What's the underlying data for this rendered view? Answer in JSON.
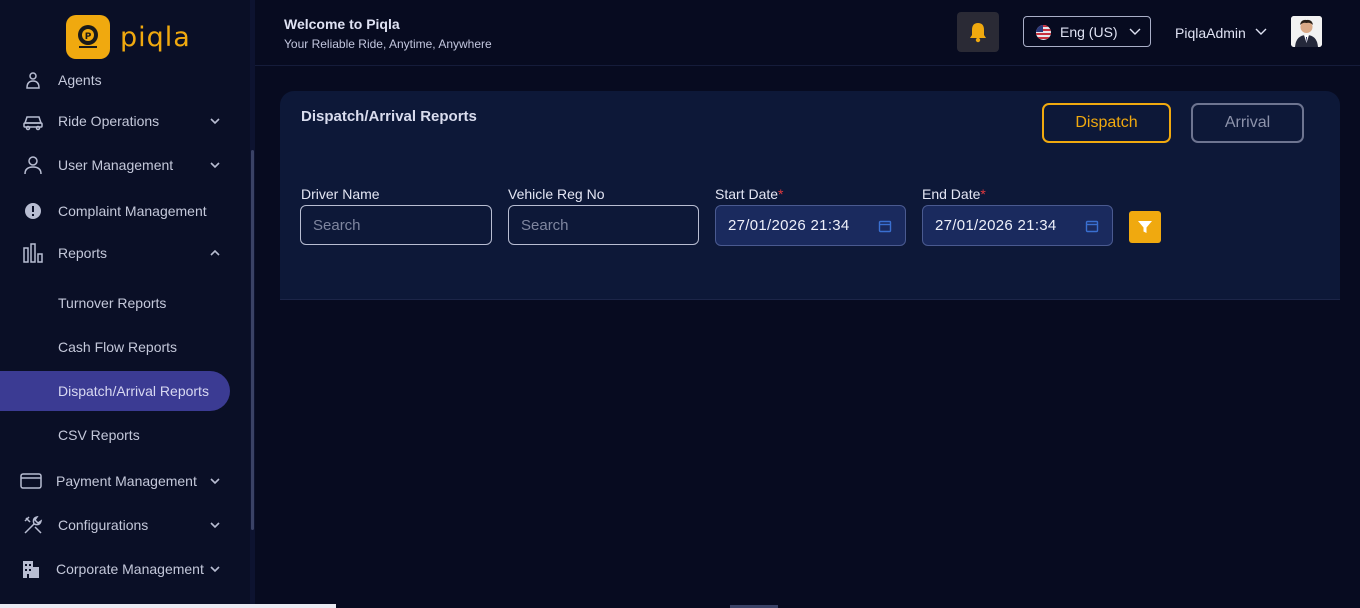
{
  "app": {
    "logo_text": "piqla"
  },
  "sidebar": {
    "items": [
      {
        "label": "Agents",
        "icon": "agents-icon"
      },
      {
        "label": "Ride Operations",
        "icon": "car-icon"
      },
      {
        "label": "User Management",
        "icon": "user-icon"
      },
      {
        "label": "Complaint Management",
        "icon": "alert-circle-icon"
      },
      {
        "label": "Reports",
        "icon": "bar-chart-icon"
      },
      {
        "label": "Payment Management",
        "icon": "credit-card-icon"
      },
      {
        "label": "Configurations",
        "icon": "tools-icon"
      },
      {
        "label": "Corporate Management",
        "icon": "building-icon"
      }
    ],
    "report_subitems": [
      {
        "label": "Turnover Reports"
      },
      {
        "label": "Cash Flow Reports"
      },
      {
        "label": "Dispatch/Arrival Reports",
        "active": true
      },
      {
        "label": "CSV Reports"
      }
    ]
  },
  "header": {
    "welcome": "Welcome to Piqla",
    "tagline": "Your Reliable Ride, Anytime, Anywhere",
    "language": "Eng (US)",
    "user_name": "PiqlaAdmin"
  },
  "page": {
    "title": "Dispatch/Arrival Reports",
    "dispatch_label": "Dispatch",
    "arrival_label": "Arrival",
    "driver_name_label": "Driver Name",
    "driver_name_placeholder": "Search",
    "vehicle_label": "Vehicle Reg No",
    "vehicle_placeholder": "Search",
    "start_date_label": "Start Date",
    "start_date_value": "27/01/2026 21:34",
    "end_date_label": "End Date",
    "end_date_value": "27/01/2026 21:34",
    "required_mark": "*"
  },
  "colors": {
    "accent": "#f0a90f",
    "active_nav": "#3b3b93",
    "background": "#070b20",
    "card": "#0d1838"
  }
}
